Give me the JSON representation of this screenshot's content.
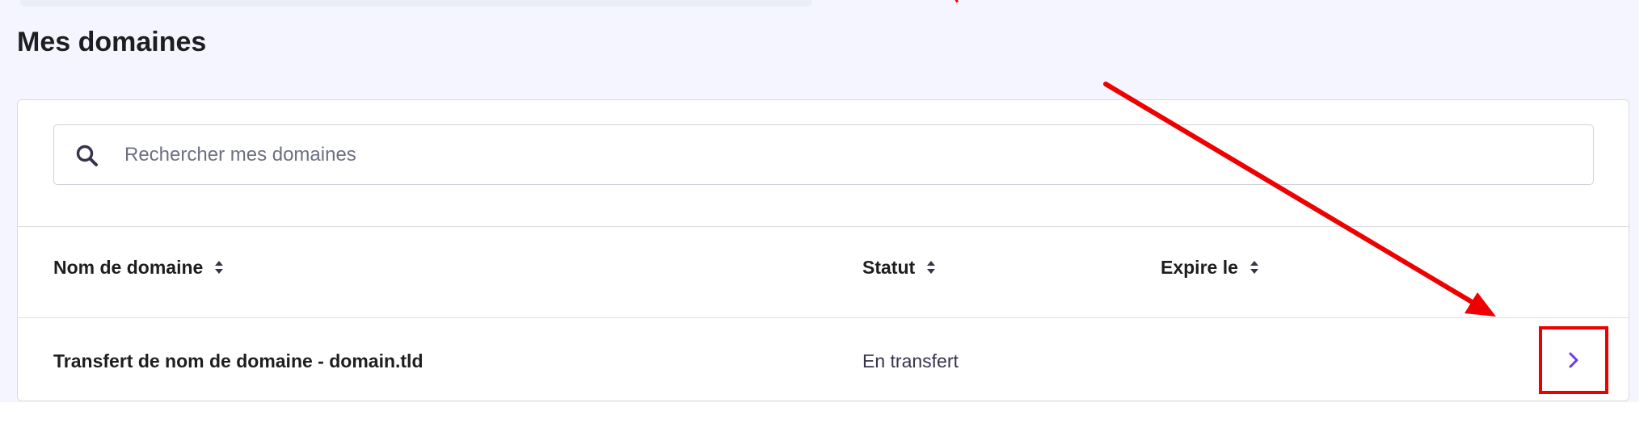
{
  "page": {
    "title": "Mes domaines"
  },
  "search": {
    "placeholder": "Rechercher mes domaines",
    "icon": "search-icon"
  },
  "table": {
    "columns": [
      {
        "label": "Nom de domaine",
        "sortable": true
      },
      {
        "label": "Statut",
        "sortable": true
      },
      {
        "label": "Expire le",
        "sortable": true
      }
    ],
    "rows": [
      {
        "domain": "Transfert de nom de domaine - domain.tld",
        "status": "En transfert",
        "expires": "",
        "action_icon": "chevron-right-icon"
      }
    ]
  },
  "colors": {
    "page_background": "#f4f5ff",
    "card_background": "#ffffff",
    "border": "#dadce0",
    "text_primary": "#1d1e20",
    "text_secondary": "#36344d",
    "accent": "#673de6",
    "annotation": "#ee0000"
  }
}
